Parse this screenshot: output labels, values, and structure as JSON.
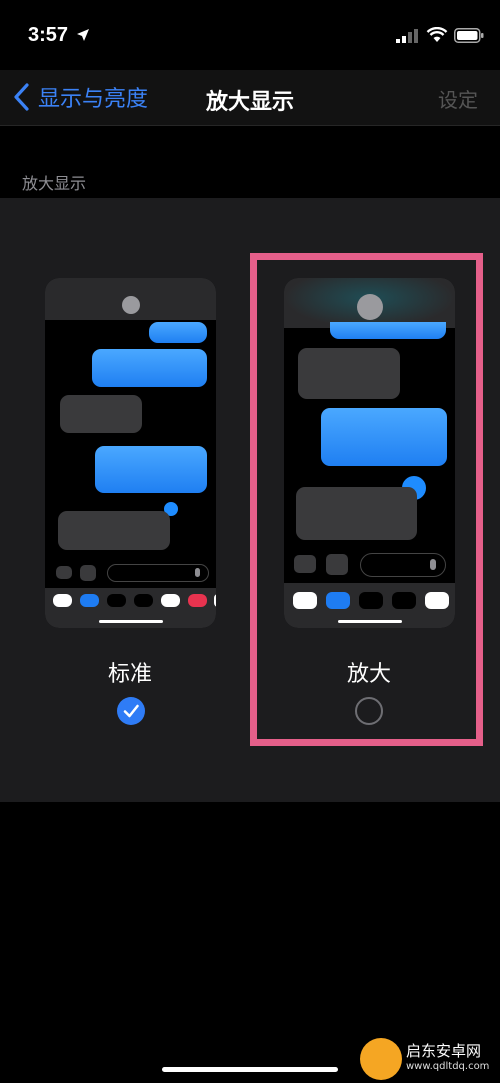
{
  "status": {
    "time": "3:57"
  },
  "nav": {
    "back_label": "显示与亮度",
    "title": "放大显示",
    "settings_label": "设定"
  },
  "section": {
    "header": "放大显示"
  },
  "options": {
    "standard": {
      "label": "标准",
      "selected": true
    },
    "zoomed": {
      "label": "放大",
      "selected": false
    }
  },
  "watermark": {
    "name": "启东安卓网",
    "url": "www.qdltdq.com"
  },
  "colors": {
    "accent": "#3b82f6",
    "highlight": "#e55f8a",
    "bubble_out": "#1f7ff2",
    "bubble_in": "#3a3a3c"
  }
}
